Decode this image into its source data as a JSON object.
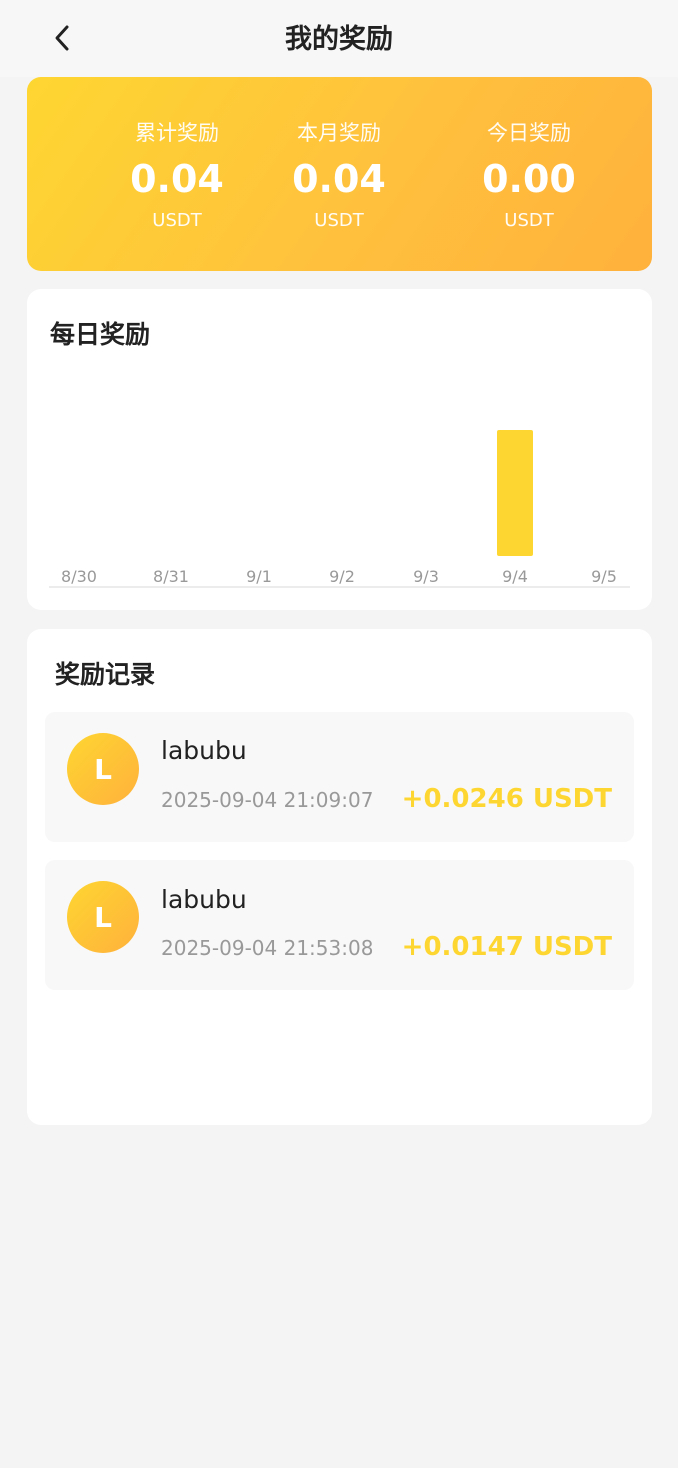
{
  "header": {
    "title": "我的奖励"
  },
  "summary": [
    {
      "label": "累计奖励",
      "value": "0.04",
      "unit": "USDT"
    },
    {
      "label": "本月奖励",
      "value": "0.04",
      "unit": "USDT"
    },
    {
      "label": "今日奖励",
      "value": "0.00",
      "unit": "USDT"
    }
  ],
  "daily": {
    "title": "每日奖励"
  },
  "chart_data": {
    "type": "bar",
    "categories": [
      "8/30",
      "8/31",
      "9/1",
      "9/2",
      "9/3",
      "9/4",
      "9/5"
    ],
    "values": [
      0,
      0,
      0,
      0,
      0,
      0.0393,
      0
    ],
    "ylim": [
      0,
      0.0393
    ],
    "grid": false,
    "bar_color": "#fed631"
  },
  "records": {
    "title": "奖励记录",
    "items": [
      {
        "avatar": "L",
        "name": "labubu",
        "time": "2025-09-04 21:09:07",
        "amount": "+0.0246 USDT"
      },
      {
        "avatar": "L",
        "name": "labubu",
        "time": "2025-09-04 21:53:08",
        "amount": "+0.0147 USDT"
      }
    ]
  },
  "colors": {
    "accent": "#fed631",
    "accent_end": "#ffb13c",
    "background": "#f4f4f4"
  }
}
